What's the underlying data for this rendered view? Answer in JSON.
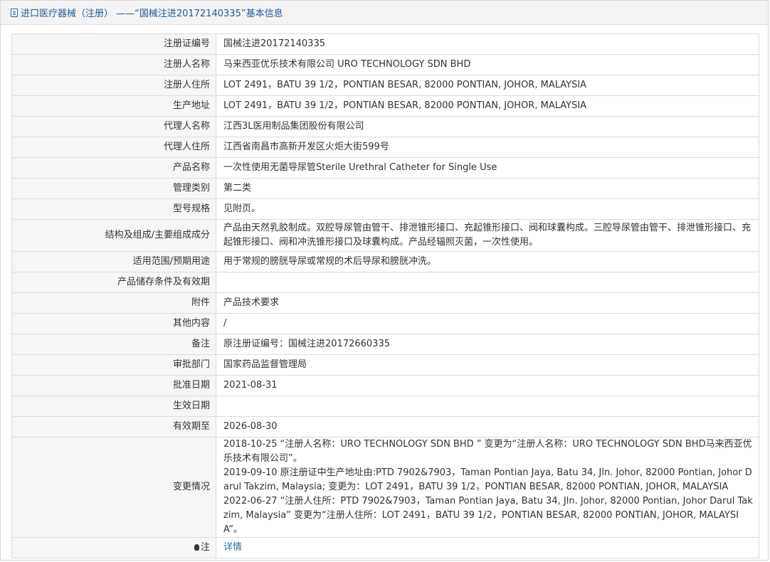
{
  "header": {
    "title": "进口医疗器械（注册） ——“国械注进20172140335”基本信息",
    "icon": "document-icon"
  },
  "rows": [
    {
      "label": "注册证编号",
      "value": "国械注进20172140335"
    },
    {
      "label": "注册人名称",
      "value": "马来西亚优乐技术有限公司 URO TECHNOLOGY SDN BHD"
    },
    {
      "label": "注册人住所",
      "value": "LOT 2491，BATU 39 1/2，PONTIAN BESAR, 82000 PONTIAN, JOHOR, MALAYSIA"
    },
    {
      "label": "生产地址",
      "value": "LOT 2491，BATU 39 1/2，PONTIAN BESAR, 82000 PONTIAN, JOHOR, MALAYSIA"
    },
    {
      "label": "代理人名称",
      "value": "江西3L医用制品集团股份有限公司"
    },
    {
      "label": "代理人住所",
      "value": "江西省南昌市高新开发区火炬大街599号"
    },
    {
      "label": "产品名称",
      "value": "一次性使用无菌导尿管Sterile Urethral Catheter for Single Use"
    },
    {
      "label": "管理类别",
      "value": "第二类"
    },
    {
      "label": "型号规格",
      "value": "见附页。"
    },
    {
      "label": "结构及组成/主要组成成分",
      "value": "产品由天然乳胶制成。双腔导尿管由管干、排泄锥形接口、充起锥形接口、阀和球囊构成。三腔导尿管由管干、排泄锥形接口、充起锥形接口、阀和冲洗锥形接口及球囊构成。产品经辐照灭菌，一次性使用。"
    },
    {
      "label": "适用范围/预期用途",
      "value": "用于常规的膀胱导尿或常规的术后导尿和膀胱冲洗。"
    },
    {
      "label": "产品储存条件及有效期",
      "value": ""
    },
    {
      "label": "附件",
      "value": "产品技术要求"
    },
    {
      "label": "其他内容",
      "value": "/"
    },
    {
      "label": "备注",
      "value": "原注册证编号：国械注进20172660335"
    },
    {
      "label": "审批部门",
      "value": "国家药品监督管理局"
    },
    {
      "label": "批准日期",
      "value": "2021-08-31"
    },
    {
      "label": "生效日期",
      "value": ""
    },
    {
      "label": "有效期至",
      "value": "2026-08-30"
    }
  ],
  "changes": {
    "label": "变更情况",
    "entries": [
      "2018-10-25 “注册人名称：URO TECHNOLOGY SDN BHD ” 变更为“注册人名称：URO TECHNOLOGY SDN BHD马来西亚优乐技术有限公司”。",
      "2019-09-10 原注册证中生产地址由:PTD 7902&7903，Taman Pontian Jaya, Batu 34, Jln. Johor, 82000 Pontian, Johor Darul Takzim, Malaysia; 变更为：LOT 2491，BATU 39 1/2，PONTIAN BESAR, 82000 PONTIAN, JOHOR, MALAYSIA",
      "2022-06-27 “注册人住所：PTD 7902&7903，Taman Pontian Jaya, Batu 34, Jln. Johor, 82000 Pontian, Johor Darul Takzim, Malaysia” 变更为“注册人住所：LOT 2491，BATU 39 1/2，PONTIAN BESAR, 82000 PONTIAN, JOHOR, MALAYSIA”。"
    ]
  },
  "note": {
    "label": "注",
    "icon": "bulb-icon",
    "link_text": "详情"
  }
}
